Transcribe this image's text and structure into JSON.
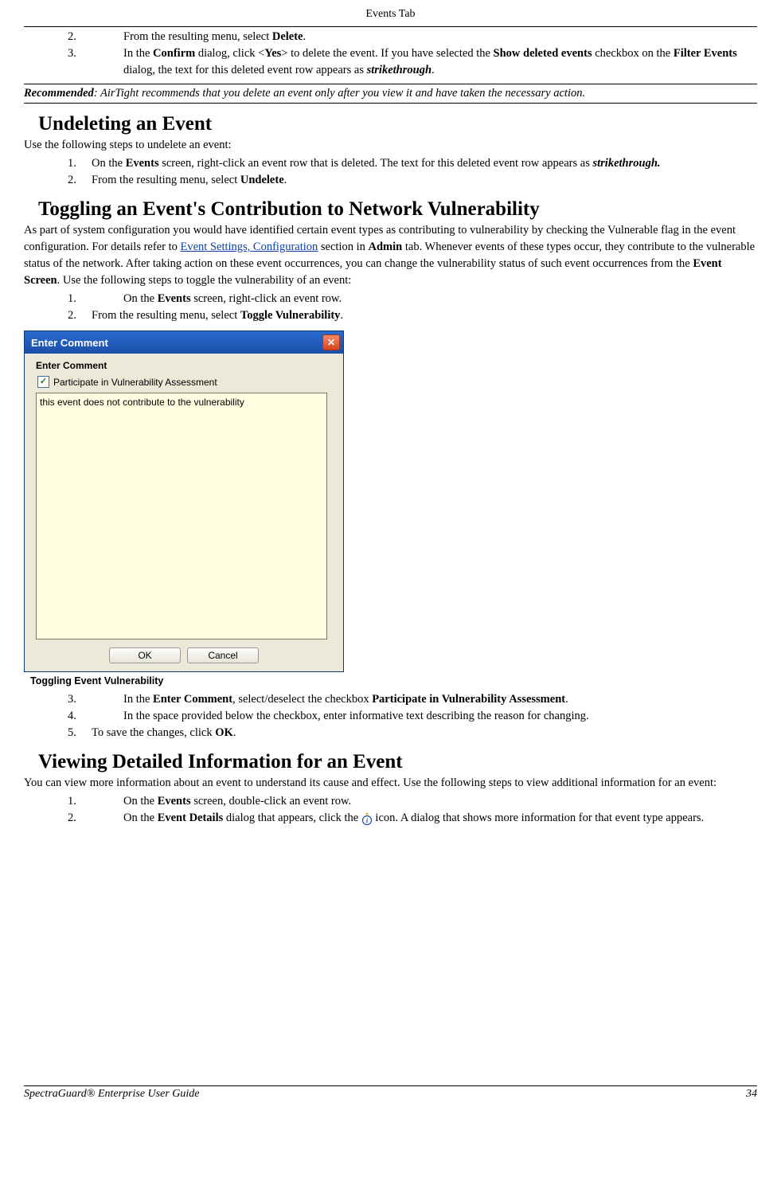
{
  "header": "Events Tab",
  "top_list": {
    "i2": {
      "num": "2.",
      "pre": "From the resulting menu, select ",
      "b1": "Delete",
      "post": "."
    },
    "i3": {
      "num": "3.",
      "t1": "In the ",
      "b1": "Confirm",
      "t2": " dialog, click <",
      "b2": "Yes",
      "t3": "> to delete the event. If you have selected the ",
      "b3": "Show deleted events",
      "t4": " checkbox on the ",
      "b4": "Filter Events",
      "t5": " dialog, the text for this deleted event row appears as ",
      "bi": "strikethrough",
      "t6": "."
    }
  },
  "note": {
    "b": "Recommended",
    "rest": ": AirTight recommends that you delete an event only after you view it and have taken the necessary action."
  },
  "undel": {
    "h": "Undeleting an Event",
    "intro": "Use the following steps to undelete an event:",
    "i1": {
      "num": "1.",
      "t1": "On the ",
      "b1": "Events",
      "t2": " screen, right-click an event row that is deleted. The text for this deleted event row appears as ",
      "bi": "strikethrough."
    },
    "i2": {
      "num": "2.",
      "t1": "From the resulting menu, select ",
      "b1": "Undelete",
      "t2": "."
    }
  },
  "toggle": {
    "h": "Toggling an Event's Contribution to Network Vulnerability",
    "p": {
      "t1": "As part of system configuration you would have identified certain event types as contributing to vulnerability by checking the Vulnerable flag in the event configuration. For details refer to ",
      "link": "Event Settings, Configuration",
      "t2": " section in ",
      "b1": "Admin",
      "t3": " tab. Whenever events of these types occur, they contribute to the vulnerable status of the network. After taking action on these event occurrences, you can change the vulnerability status of such event occurrences from the ",
      "b2": "Event Screen",
      "t4": ". Use the following steps to toggle the vulnerability of an event:"
    },
    "i1": {
      "num": "1.",
      "t1": "On the ",
      "b1": "Events",
      "t2": " screen, right-click an event row."
    },
    "i2": {
      "num": "2.",
      "t1": "From the resulting menu, select ",
      "b1": "Toggle Vulnerability",
      "t2": "."
    }
  },
  "dialog": {
    "title": "Enter Comment",
    "subtitle": "Enter Comment",
    "checkbox_label": "Participate in Vulnerability Assessment",
    "checkbox_checked": true,
    "textarea_value": "this event does not contribute to the vulnerability",
    "ok": "OK",
    "cancel": "Cancel"
  },
  "caption": "Toggling Event Vulnerability",
  "after_dialog": {
    "i3": {
      "num": "3.",
      "t1": "In the ",
      "b1": "Enter Comment",
      "t2": ", select/deselect the checkbox ",
      "b2": "Participate in Vulnerability Assessment",
      "t3": "."
    },
    "i4": {
      "num": "4.",
      "t1": "In the space provided below the checkbox, enter informative text describing the reason for changing."
    },
    "i5": {
      "num": "5.",
      "t1": "To save the changes, click ",
      "b1": "OK",
      "t2": "."
    }
  },
  "viewing": {
    "h": "Viewing Detailed Information for an Event",
    "intro": "You can view more information about an event to understand its cause and effect. Use the following steps to view additional information for an event:",
    "i1": {
      "num": "1.",
      "t1": "On the ",
      "b1": "Events",
      "t2": " screen, double-click an event row."
    },
    "i2": {
      "num": "2.",
      "t1": "On the ",
      "b1": "Event Details",
      "t2": " dialog that appears, click the ",
      "t3": " icon. A dialog that shows more information for that event type appears."
    }
  },
  "footer": {
    "left": "SpectraGuard® Enterprise User Guide",
    "right": "34"
  }
}
